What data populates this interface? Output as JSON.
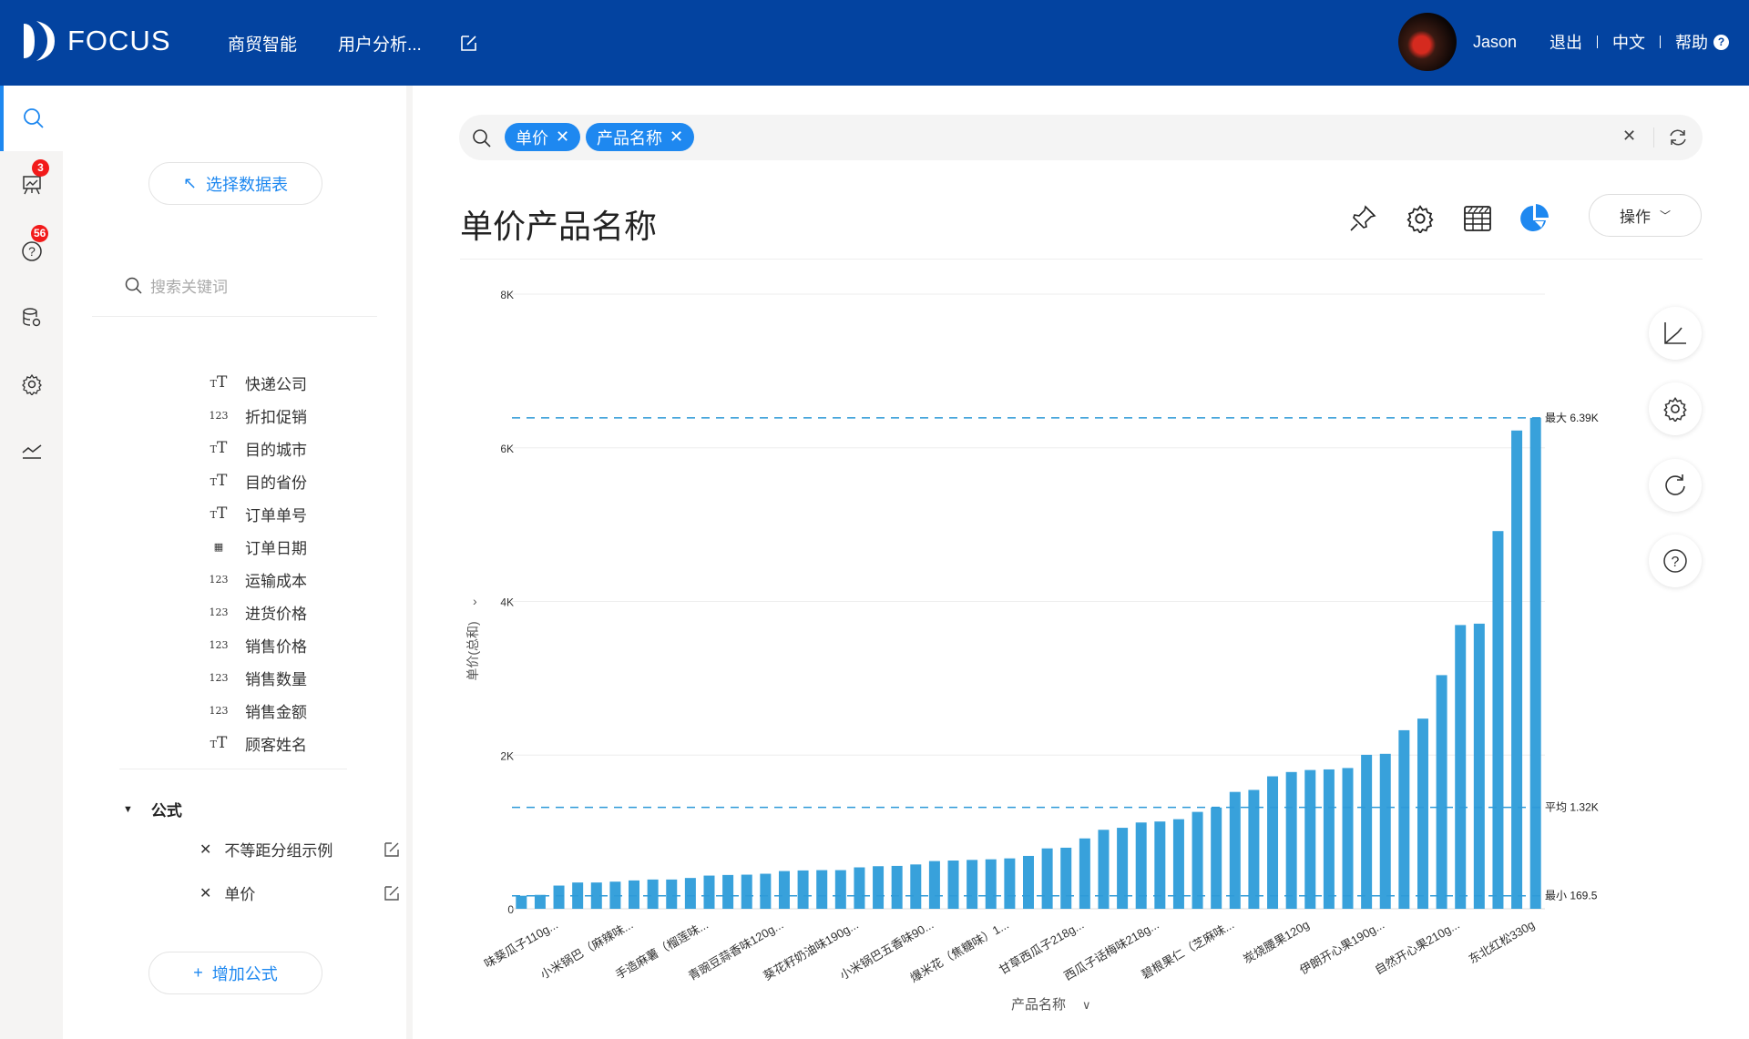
{
  "header": {
    "logo_text": "FOCUS",
    "nav": [
      "商贸智能",
      "用户分析..."
    ],
    "user_name": "Jason",
    "logout": "退出",
    "language": "中文",
    "help": "帮助",
    "color": "#0343a0"
  },
  "rail": {
    "badges": {
      "presentation": "3",
      "questions": "56"
    }
  },
  "panel": {
    "select_table": "选择数据表",
    "search_placeholder": "搜索关键词",
    "fields": [
      {
        "icon": "text",
        "label": "快递公司"
      },
      {
        "icon": "number",
        "label": "折扣促销"
      },
      {
        "icon": "text",
        "label": "目的城市"
      },
      {
        "icon": "text",
        "label": "目的省份"
      },
      {
        "icon": "text",
        "label": "订单单号"
      },
      {
        "icon": "date",
        "label": "订单日期"
      },
      {
        "icon": "number",
        "label": "运输成本"
      },
      {
        "icon": "number",
        "label": "进货价格"
      },
      {
        "icon": "number",
        "label": "销售价格"
      },
      {
        "icon": "number",
        "label": "销售数量"
      },
      {
        "icon": "number",
        "label": "销售金额"
      },
      {
        "icon": "text",
        "label": "顾客姓名"
      }
    ],
    "formula_header": "公式",
    "formulas": [
      "不等距分组示例",
      "单价"
    ],
    "add_formula": "增加公式"
  },
  "search": {
    "tags": [
      "单价",
      "产品名称"
    ]
  },
  "main": {
    "title": "单价产品名称",
    "ops_label": "操作",
    "accent": "#1e88f0"
  },
  "chart_data": {
    "type": "bar",
    "xlabel": "产品名称",
    "ylabel": "单价(总和)",
    "ylim": [
      0,
      8000
    ],
    "y_ticks": [
      "0",
      "2K",
      "4K",
      "6K",
      "8K"
    ],
    "y_tick_values": [
      0,
      2000,
      4000,
      6000,
      8000
    ],
    "grid": true,
    "bar_color": "#38a1db",
    "values": [
      169.5,
      181,
      302,
      342,
      342,
      353,
      369,
      381,
      381,
      401,
      432,
      440,
      444,
      456,
      491,
      499,
      503,
      503,
      539,
      554,
      558,
      577,
      621,
      628,
      636,
      644,
      656,
      688,
      786,
      795,
      916,
      1028,
      1054,
      1123,
      1136,
      1166,
      1261,
      1318,
      1521,
      1547,
      1724,
      1780,
      1806,
      1814,
      1832,
      2004,
      2017,
      2324,
      2475,
      3041,
      3693,
      3711,
      4916,
      6225,
      6390
    ],
    "tick_labels": [
      {
        "bar": 2,
        "text": "味葵瓜子110g..."
      },
      {
        "bar": 6,
        "text": "小米锅巴（麻辣味..."
      },
      {
        "bar": 10,
        "text": "手造麻薯（榴莲味..."
      },
      {
        "bar": 14,
        "text": "青豌豆蒜香味120g..."
      },
      {
        "bar": 18,
        "text": "葵花籽奶油味190g..."
      },
      {
        "bar": 22,
        "text": "小米锅巴五香味90..."
      },
      {
        "bar": 26,
        "text": "爆米花（焦糖味）1..."
      },
      {
        "bar": 30,
        "text": "甘草西瓜子218g..."
      },
      {
        "bar": 34,
        "text": "西瓜子话梅味218g..."
      },
      {
        "bar": 38,
        "text": "碧根果仁（芝麻味..."
      },
      {
        "bar": 42,
        "text": "炭烧腰果120g"
      },
      {
        "bar": 46,
        "text": "伊朗开心果190g..."
      },
      {
        "bar": 50,
        "text": "自然开心果210g..."
      },
      {
        "bar": 54,
        "text": "东北红松330g"
      }
    ],
    "reference_lines": [
      {
        "label": "最大 6.39K",
        "value": 6390
      },
      {
        "label": "平均 1.32K",
        "value": 1320
      },
      {
        "label": "最小 169.5",
        "value": 169.5
      }
    ]
  }
}
